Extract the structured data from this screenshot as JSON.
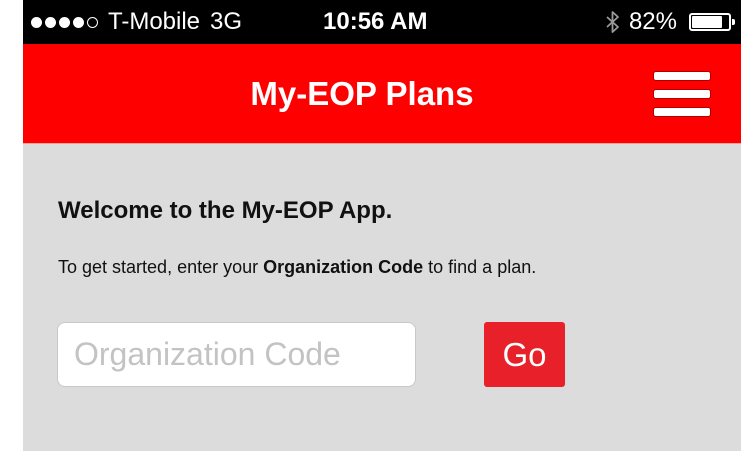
{
  "status_bar": {
    "signal_bars_filled": 4,
    "signal_bars_total": 5,
    "carrier": "T-Mobile",
    "network": "3G",
    "time": "10:56 AM",
    "bluetooth_icon": "bluetooth-icon",
    "battery_percent": "82%",
    "battery_level": 0.82
  },
  "header": {
    "title": "My-EOP Plans",
    "menu_icon": "hamburger-menu-icon",
    "background_color": "#ff0000"
  },
  "main": {
    "welcome_heading": "Welcome to the My-EOP App.",
    "instructions_prefix": "To get started, enter your ",
    "instructions_bold": "Organization Code",
    "instructions_suffix": " to find a plan.",
    "org_code_input": {
      "placeholder": "Organization Code",
      "value": ""
    },
    "go_button_label": "Go",
    "go_button_color": "#e8202a"
  }
}
